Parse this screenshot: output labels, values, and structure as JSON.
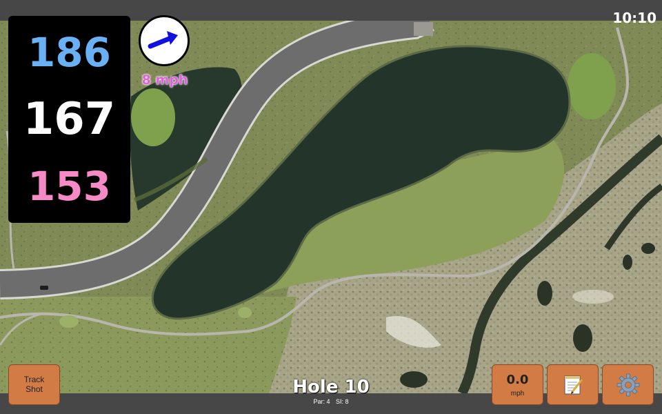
{
  "status": {
    "time": "10:10"
  },
  "yardages": {
    "back": "186",
    "middle": "167",
    "front": "153"
  },
  "wind": {
    "speed": "8 mph",
    "icon": "wind-arrow-icon"
  },
  "buttons": {
    "track_line1": "Track",
    "track_line2": "Shot",
    "speed_value": "0.0",
    "speed_unit": "mph",
    "notes_icon": "notepad-icon",
    "settings_icon": "gear-icon"
  },
  "hole": {
    "title": "Hole 10",
    "par": "Par: 4",
    "si": "SI: 8"
  },
  "colors": {
    "back_yardage": "#6ab0f5",
    "middle_yardage": "#ffffff",
    "front_yardage": "#f58ac6",
    "wind_text": "#e062d8",
    "button": "#d27b45",
    "water": "#23352a",
    "grass": "#7a8a4c"
  }
}
